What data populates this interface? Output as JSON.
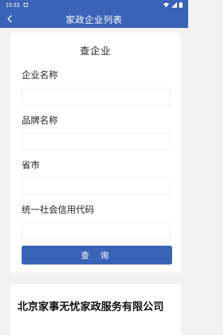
{
  "status_bar": {
    "time": "10:33"
  },
  "header": {
    "back_icon": "chevron-left-icon",
    "title": "家政企业列表"
  },
  "form": {
    "title": "查企业",
    "fields": [
      {
        "label": "企业名称",
        "value": "",
        "placeholder": ""
      },
      {
        "label": "品牌名称",
        "value": "",
        "placeholder": ""
      },
      {
        "label": "省市",
        "value": "",
        "placeholder": ""
      },
      {
        "label": "统一社会信用代码",
        "value": "",
        "placeholder": ""
      }
    ],
    "search_label": "查 询"
  },
  "results": [
    {
      "company_name": "北京家事无忧家政服务有限公司"
    }
  ],
  "colors": {
    "primary": "#3a63b8",
    "background": "#f2f2f2"
  }
}
